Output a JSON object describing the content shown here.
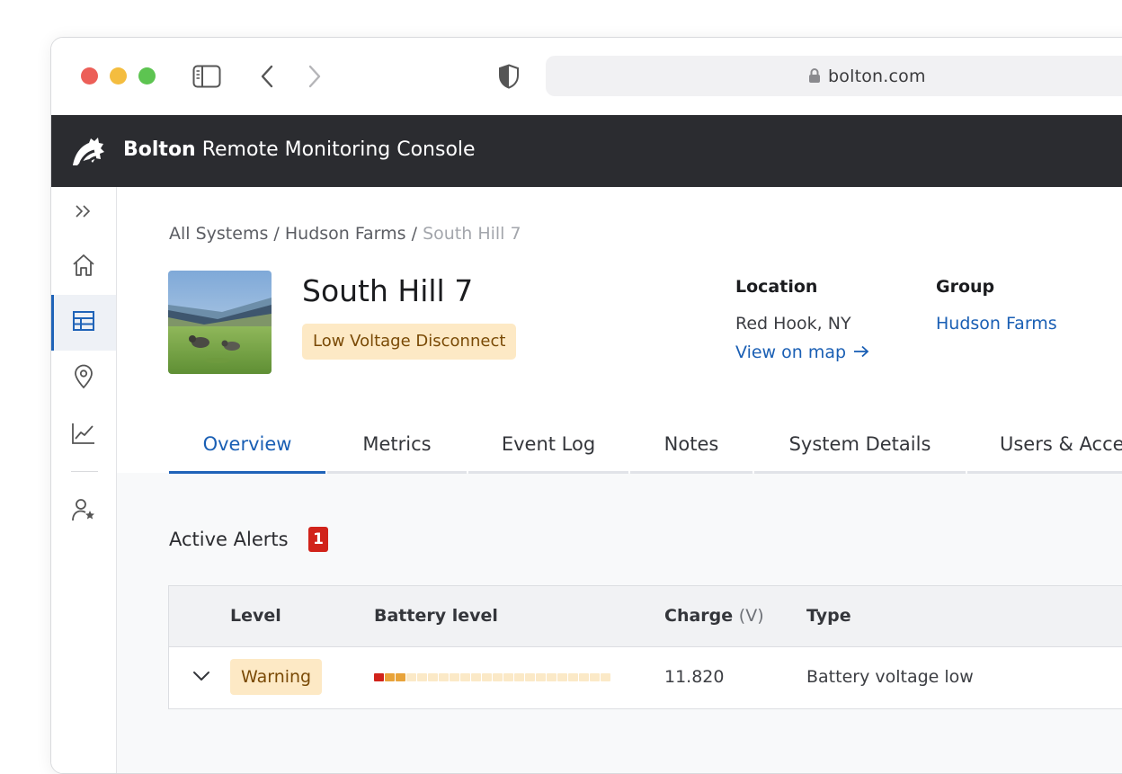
{
  "browser": {
    "url": "bolton.com"
  },
  "app": {
    "brand": "Bolton",
    "title": "Remote Monitoring Console"
  },
  "breadcrumb": {
    "items": [
      "All Systems",
      "Hudson Farms"
    ],
    "separator": "/",
    "current": "South Hill 7"
  },
  "system": {
    "name": "South Hill 7",
    "status": "Low Voltage Disconnect",
    "location_label": "Location",
    "location_value": "Red Hook, NY",
    "map_link": "View on map",
    "group_label": "Group",
    "group_value": "Hudson Farms"
  },
  "tabs": [
    {
      "label": "Overview",
      "active": true
    },
    {
      "label": "Metrics",
      "active": false
    },
    {
      "label": "Event Log",
      "active": false
    },
    {
      "label": "Notes",
      "active": false
    },
    {
      "label": "System Details",
      "active": false
    },
    {
      "label": "Users & Access",
      "active": false
    }
  ],
  "alerts": {
    "title": "Active Alerts",
    "count": "1",
    "columns": {
      "level": "Level",
      "battery": "Battery level",
      "charge": "Charge",
      "charge_unit": "(V)",
      "type": "Type"
    },
    "rows": [
      {
        "level": "Warning",
        "battery_filled_segments": 3,
        "battery_total_segments": 22,
        "charge": "11.820",
        "type": "Battery voltage low"
      }
    ]
  },
  "colors": {
    "accent": "#1f63b8",
    "header_bg": "#2b2c30",
    "warning_bg": "#fde9c5",
    "warning_text": "#7a4a06",
    "alert_badge": "#d1231a",
    "battery_critical": "#d1231a",
    "battery_low": "#e8a33a",
    "battery_empty": "#fbe9c7"
  },
  "icons": {
    "sidebar": [
      "expand-icon",
      "home-icon",
      "table-icon",
      "location-pin-icon",
      "chart-icon",
      "user-star-icon"
    ]
  }
}
